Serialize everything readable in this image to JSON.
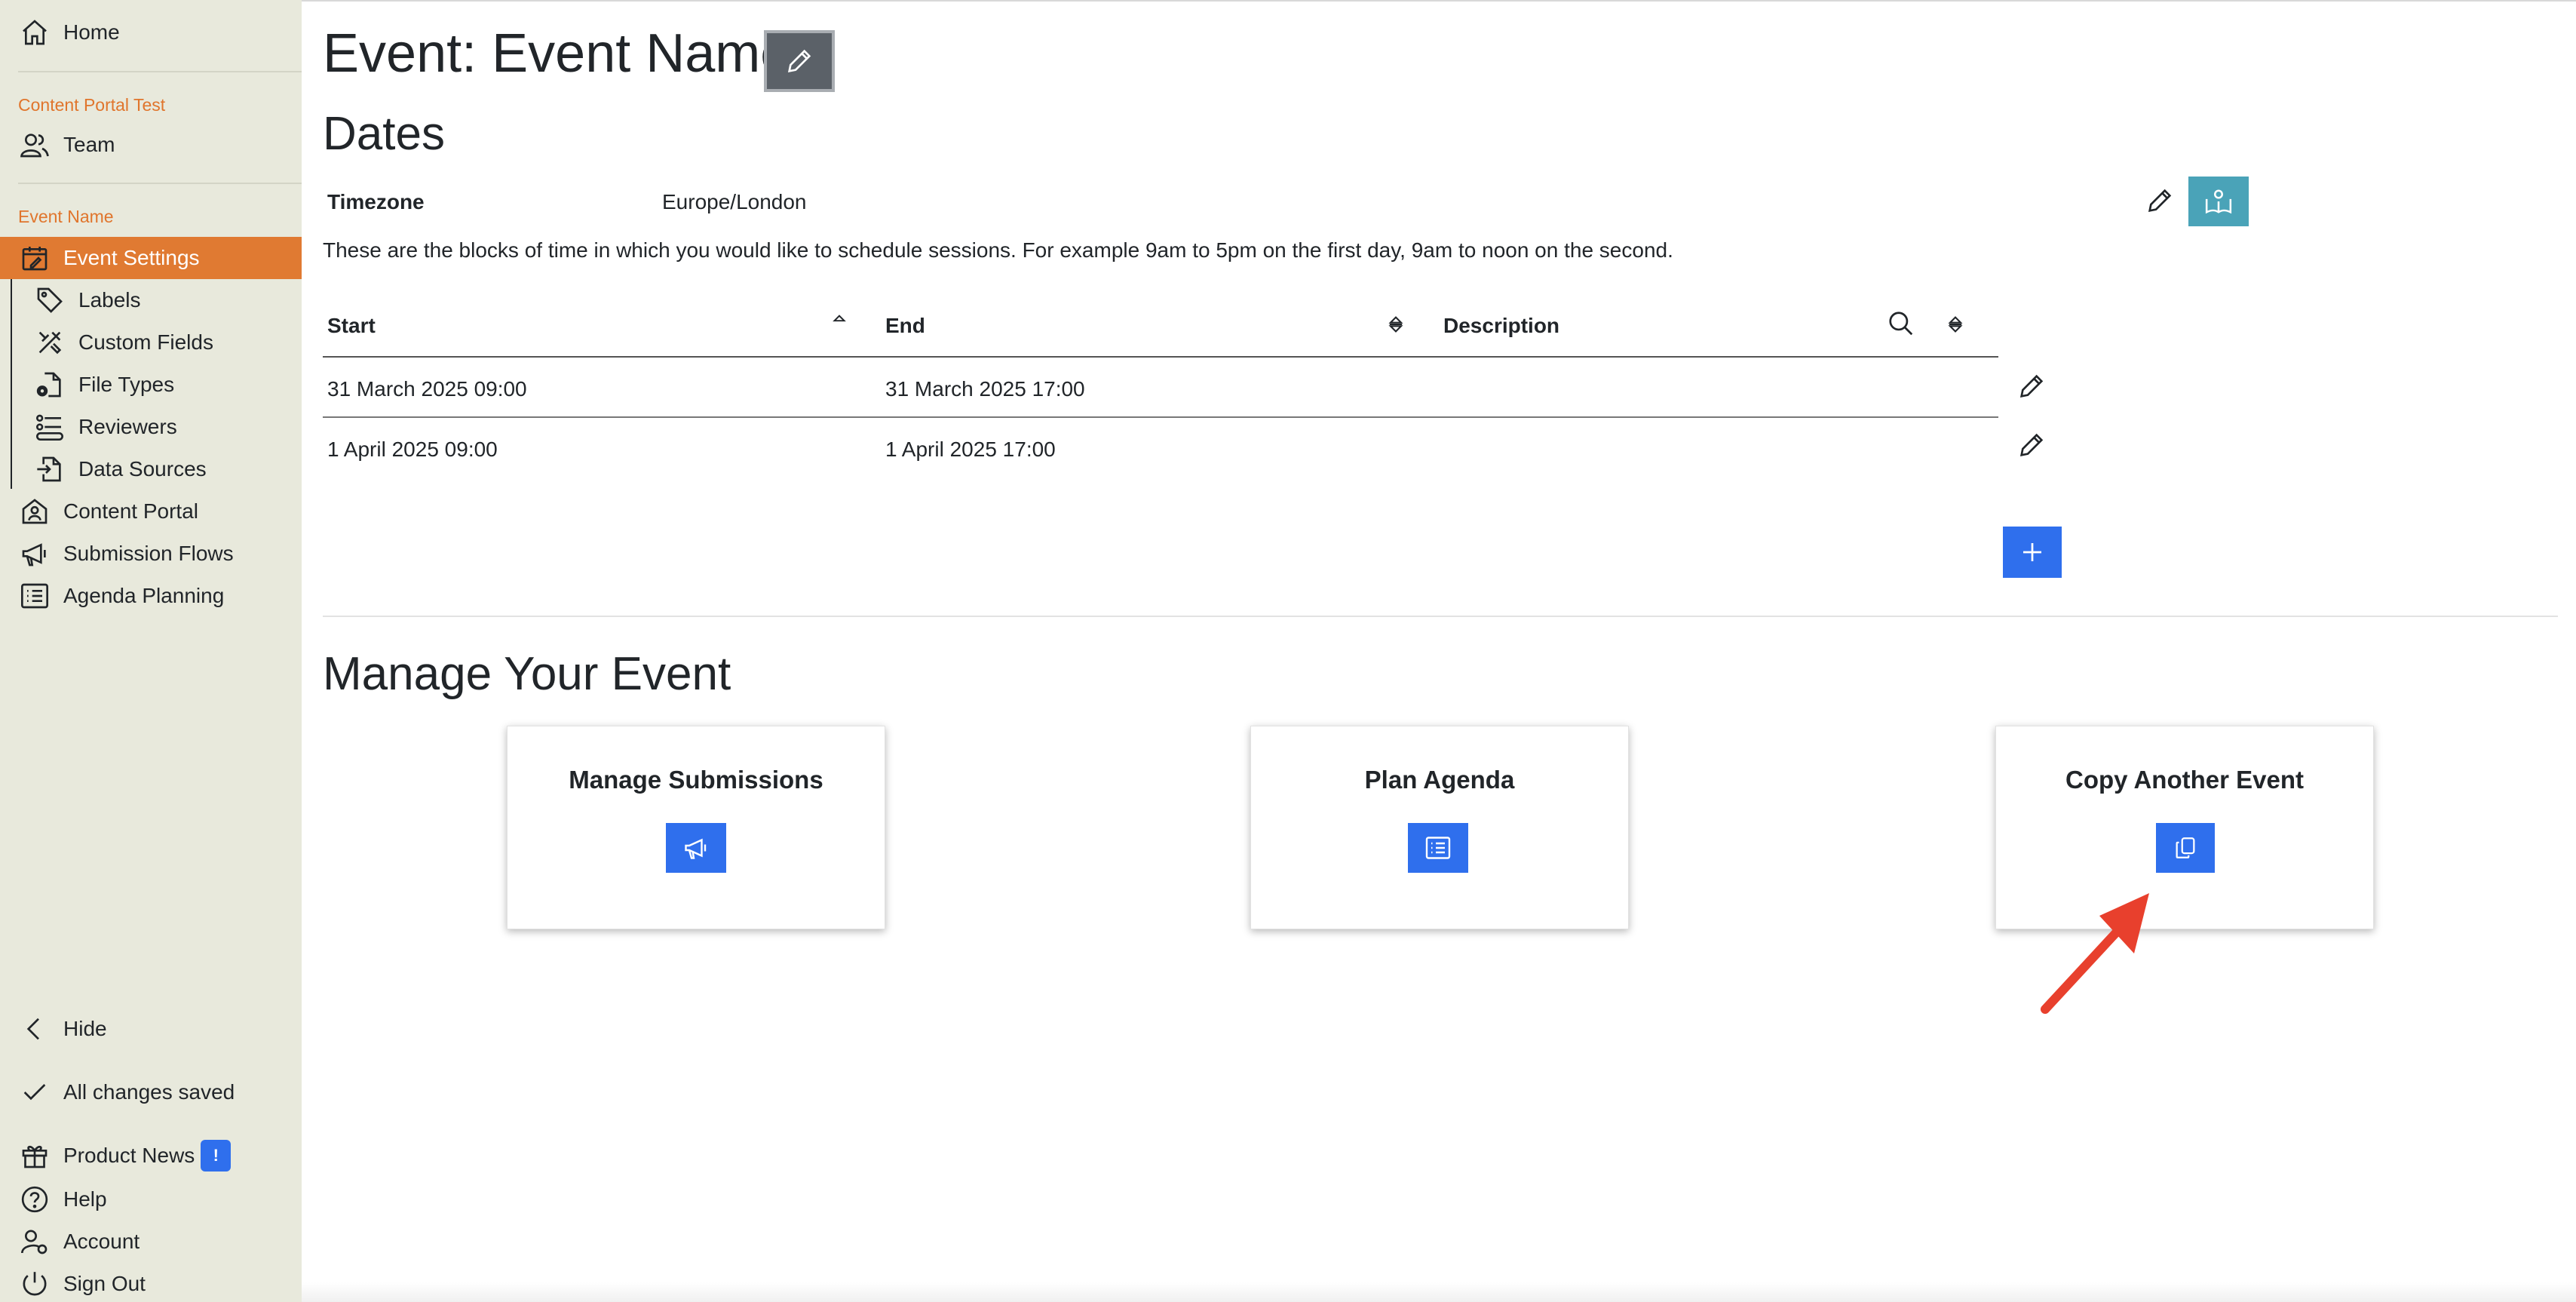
{
  "sidebar": {
    "home": "Home",
    "org_label": "Content Portal Test",
    "team": "Team",
    "event_label": "Event Name",
    "event_settings": "Event Settings",
    "sub_items": [
      "Labels",
      "Custom Fields",
      "File Types",
      "Reviewers",
      "Data Sources"
    ],
    "content_portal": "Content Portal",
    "submission_flows": "Submission Flows",
    "agenda_planning": "Agenda Planning",
    "hide": "Hide",
    "saved_status": "All changes saved",
    "product_news": "Product News",
    "product_news_badge": "!",
    "help": "Help",
    "account": "Account",
    "sign_out": "Sign Out"
  },
  "main": {
    "title": "Event: Event Name",
    "dates_heading": "Dates",
    "timezone_label": "Timezone",
    "timezone_value": "Europe/London",
    "description": "These are the blocks of time in which you would like to schedule sessions. For example 9am to 5pm on the first day, 9am to noon on the second.",
    "table": {
      "headers": [
        "Start",
        "End",
        "Description"
      ],
      "rows": [
        [
          "31 March 2025 09:00",
          "31 March 2025 17:00",
          ""
        ],
        [
          "1 April 2025 09:00",
          "1 April 2025 17:00",
          ""
        ]
      ]
    },
    "manage_heading": "Manage Your Event",
    "cards": [
      "Manage Submissions",
      "Plan Agenda",
      "Copy Another Event"
    ]
  },
  "colors": {
    "sidebar_bg": "#e8e9dc",
    "accent_orange": "#e07a32",
    "primary_blue": "#2f6fed",
    "teal": "#4aa3b8",
    "annotation_red": "#e8402d"
  }
}
